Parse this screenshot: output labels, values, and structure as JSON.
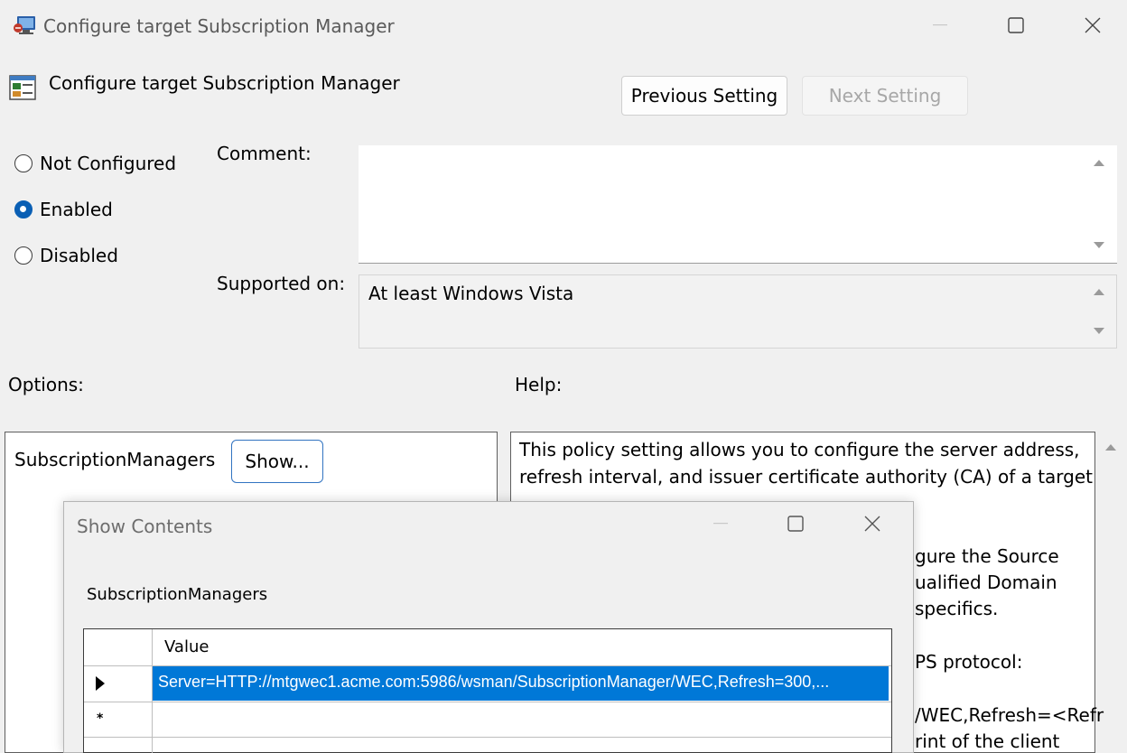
{
  "window": {
    "title": "Configure target Subscription Manager",
    "controls": {
      "minimize": "minimize-icon",
      "maximize": "maximize-icon",
      "close": "close-icon"
    }
  },
  "header": {
    "title": "Configure target Subscription Manager",
    "previous_label": "Previous Setting",
    "next_label": "Next Setting"
  },
  "state": {
    "options": [
      {
        "label": "Not Configured",
        "checked": false
      },
      {
        "label": "Enabled",
        "checked": true
      },
      {
        "label": "Disabled",
        "checked": false
      }
    ]
  },
  "comment": {
    "label": "Comment:",
    "value": ""
  },
  "supported": {
    "label": "Supported on:",
    "value": "At least Windows Vista"
  },
  "options_section": {
    "label": "Options:",
    "item_label": "SubscriptionManagers",
    "show_button": "Show..."
  },
  "help_section": {
    "label": "Help:",
    "lines": [
      "This policy setting allows you to configure the server address,",
      "refresh interval, and issuer certificate authority (CA) of a target",
      "gure the Source",
      "ualified Domain",
      "specifics.",
      "PS protocol:",
      "/WEC,Refresh=<Refr",
      "rint of the client"
    ]
  },
  "dialog": {
    "title": "Show Contents",
    "label": "SubscriptionManagers",
    "column_header": "Value",
    "rows": [
      "Server=HTTP://mtgwec1.acme.com:5986/wsman/SubscriptionManager/WEC,Refresh=300,..."
    ],
    "new_row_marker": "*"
  },
  "colors": {
    "accent": "#0078d7",
    "radio_checked": "#0a5fb4"
  }
}
